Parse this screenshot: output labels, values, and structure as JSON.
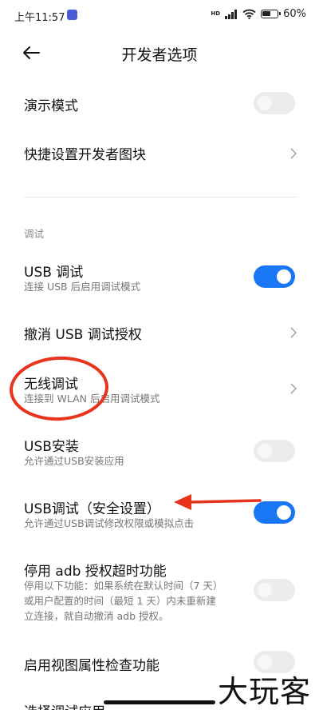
{
  "status_bar": {
    "time": "上午11:57",
    "hd": "HD",
    "battery_text": "60%",
    "battery_level": 0.6,
    "icons": [
      "signal-icon",
      "wifi-icon",
      "battery-icon"
    ]
  },
  "header": {
    "back_icon": "arrow-left-icon",
    "title": "开发者选项"
  },
  "rows": {
    "demo_mode": {
      "title": "演示模式",
      "toggle_on": false
    },
    "quick_tiles": {
      "title": "快捷设置开发者图块"
    },
    "debug_section": "调试",
    "usb_debugging": {
      "title": "USB 调试",
      "subtitle": "连接 USB 后启用调试模式",
      "toggle_on": true
    },
    "revoke_usb": {
      "title": "撤消 USB 调试授权"
    },
    "wireless_debugging": {
      "title": "无线调试",
      "subtitle": "连接到 WLAN 后启用调试模式"
    },
    "usb_install": {
      "title": "USB安装",
      "subtitle": "允许通过USB安装应用",
      "toggle_on": false
    },
    "usb_debug_security": {
      "title": "USB调试（安全设置）",
      "subtitle": "允许通过USB调试修改权限或模拟点击",
      "toggle_on": true
    },
    "adb_timeout": {
      "title": "停用 adb 授权超时功能",
      "subtitle_lines": [
        "停用以下功能：如果系统在默认时间（7 天）",
        "或用户配置的时间（最短 1 天）内未重新建",
        "立连接，就自动撤消 adb 授权。"
      ],
      "toggle_on": false
    },
    "view_attr": {
      "title": "启用视图属性检查功能",
      "toggle_on": false
    },
    "select_debug_app": {
      "title": "选择调试应用"
    }
  },
  "annotations": {
    "circle_color": "#e8341c",
    "arrow_color": "#e8341c"
  },
  "watermark": "大玩客",
  "colors": {
    "accent": "#1976f5",
    "toggle_off": "#ececec"
  }
}
